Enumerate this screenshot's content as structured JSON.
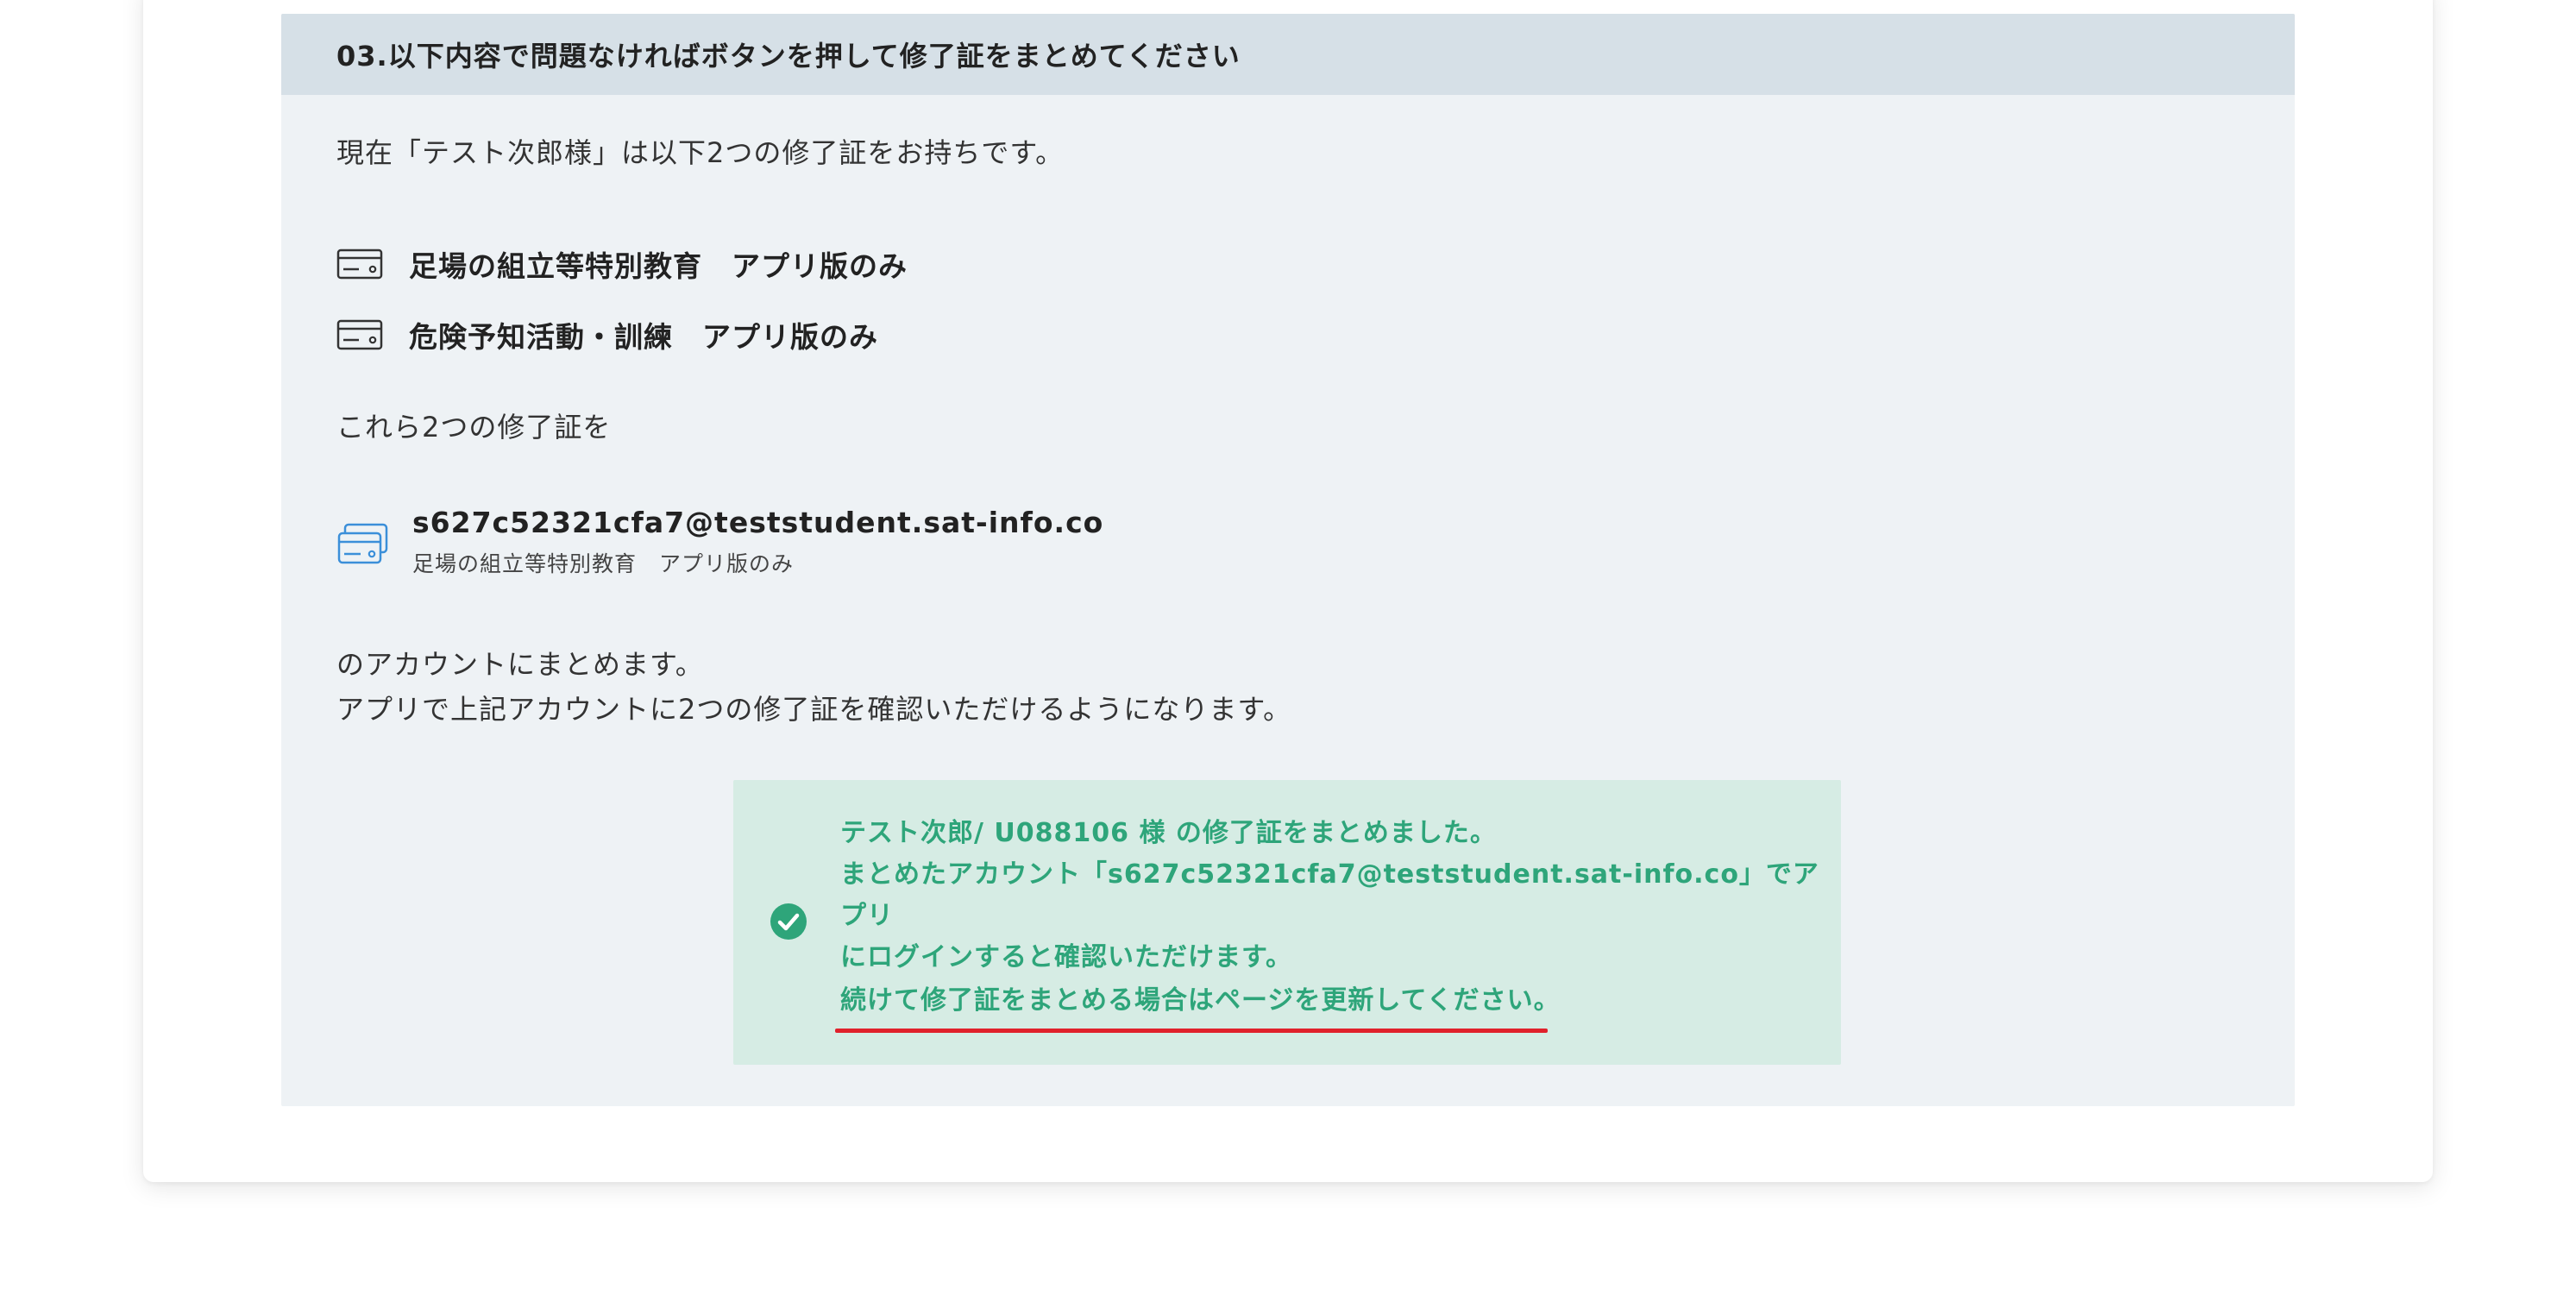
{
  "section": {
    "header": "03.以下内容で問題なければボタンを押して修了証をまとめてください",
    "intro": "現在「テスト次郎様」は以下2つの修了証をお持ちです。",
    "certificates": [
      {
        "label": "足場の組立等特別教育　アプリ版のみ"
      },
      {
        "label": "危険予知活動・訓練　アプリ版のみ"
      }
    ],
    "these_text": "これら2つの修了証を",
    "account": {
      "email": "s627c52321cfa7@teststudent.sat-info.co",
      "subtitle": "足場の組立等特別教育　アプリ版のみ"
    },
    "merge_line1": "のアカウントにまとめます。",
    "merge_line2": "アプリで上記アカウントに2つの修了証を確認いただけるようになります。"
  },
  "success": {
    "line1": "テスト次郎/ U088106 様 の修了証をまとめました。",
    "line2": "まとめたアカウント「s627c52321cfa7@teststudent.sat-info.co」でアプリ",
    "line3": "にログインすると確認いただけます。",
    "refresh_note": "続けて修了証をまとめる場合はページを更新してください。",
    "color": "#2ea57a",
    "background": "#d6ece4",
    "underline_color": "#e0212b"
  },
  "icons": {
    "certificate": "card-icon",
    "account": "cards-stack-icon",
    "success": "check-circle-icon"
  }
}
